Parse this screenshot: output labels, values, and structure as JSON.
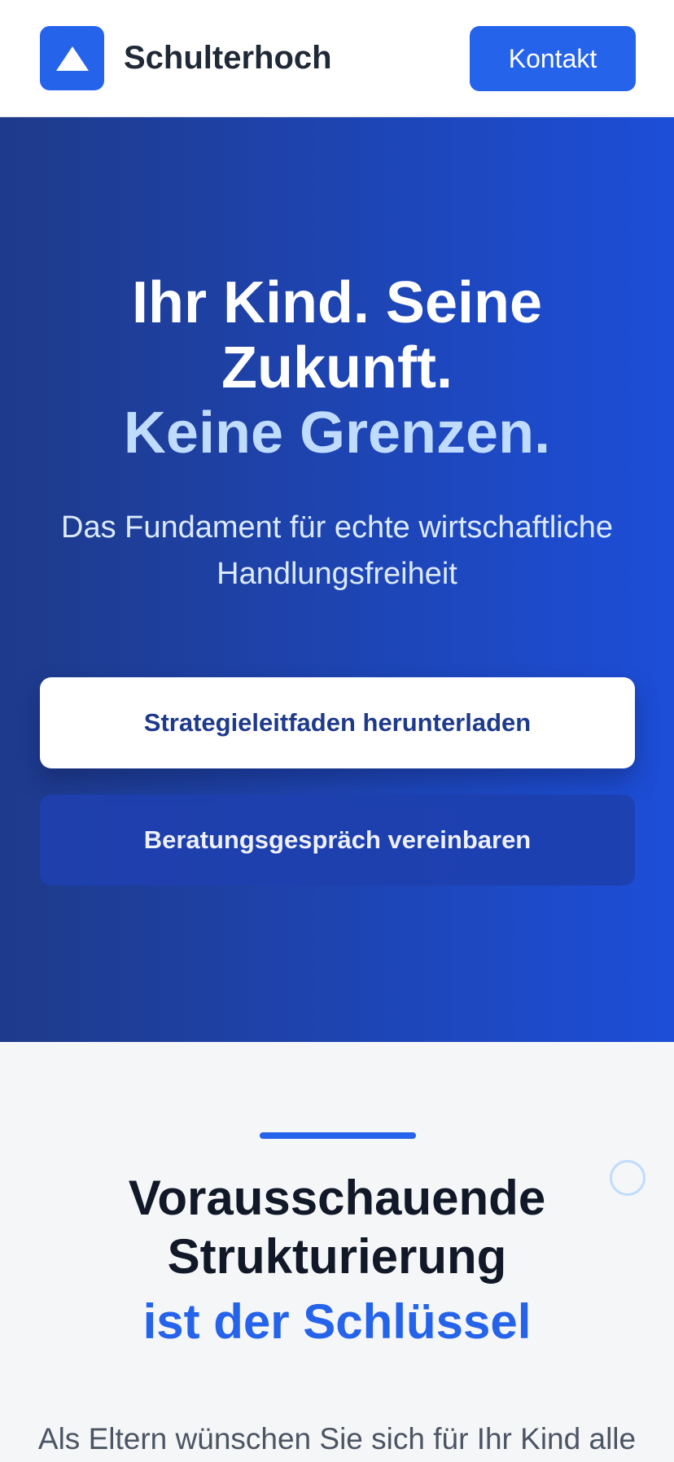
{
  "header": {
    "brand": "Schulterhoch",
    "logo_icon": "triangle-up-icon",
    "contact_label": "Kontakt"
  },
  "hero": {
    "title_line1": "Ihr Kind. Seine",
    "title_line2": "Zukunft.",
    "title_accent": "Keine Grenzen.",
    "subtitle": "Das Fundament für echte wirtschaftliche Handlungsfreiheit",
    "primary_button": "Strategieleitfaden herunterladen",
    "secondary_button": "Beratungsgespräch vereinbaren"
  },
  "section": {
    "title_line1": "Vorausschauende",
    "title_line2": "Strukturierung",
    "title_accent": "ist der Schlüssel",
    "body_start": "Als Eltern wünschen Sie sich für Ihr Kind alle"
  },
  "colors": {
    "brand_blue": "#2563eb",
    "hero_dark": "#1e3a8a",
    "hero_light": "#1d4ed8",
    "accent_light": "#bfdbfe",
    "heading_dark": "#111827"
  }
}
